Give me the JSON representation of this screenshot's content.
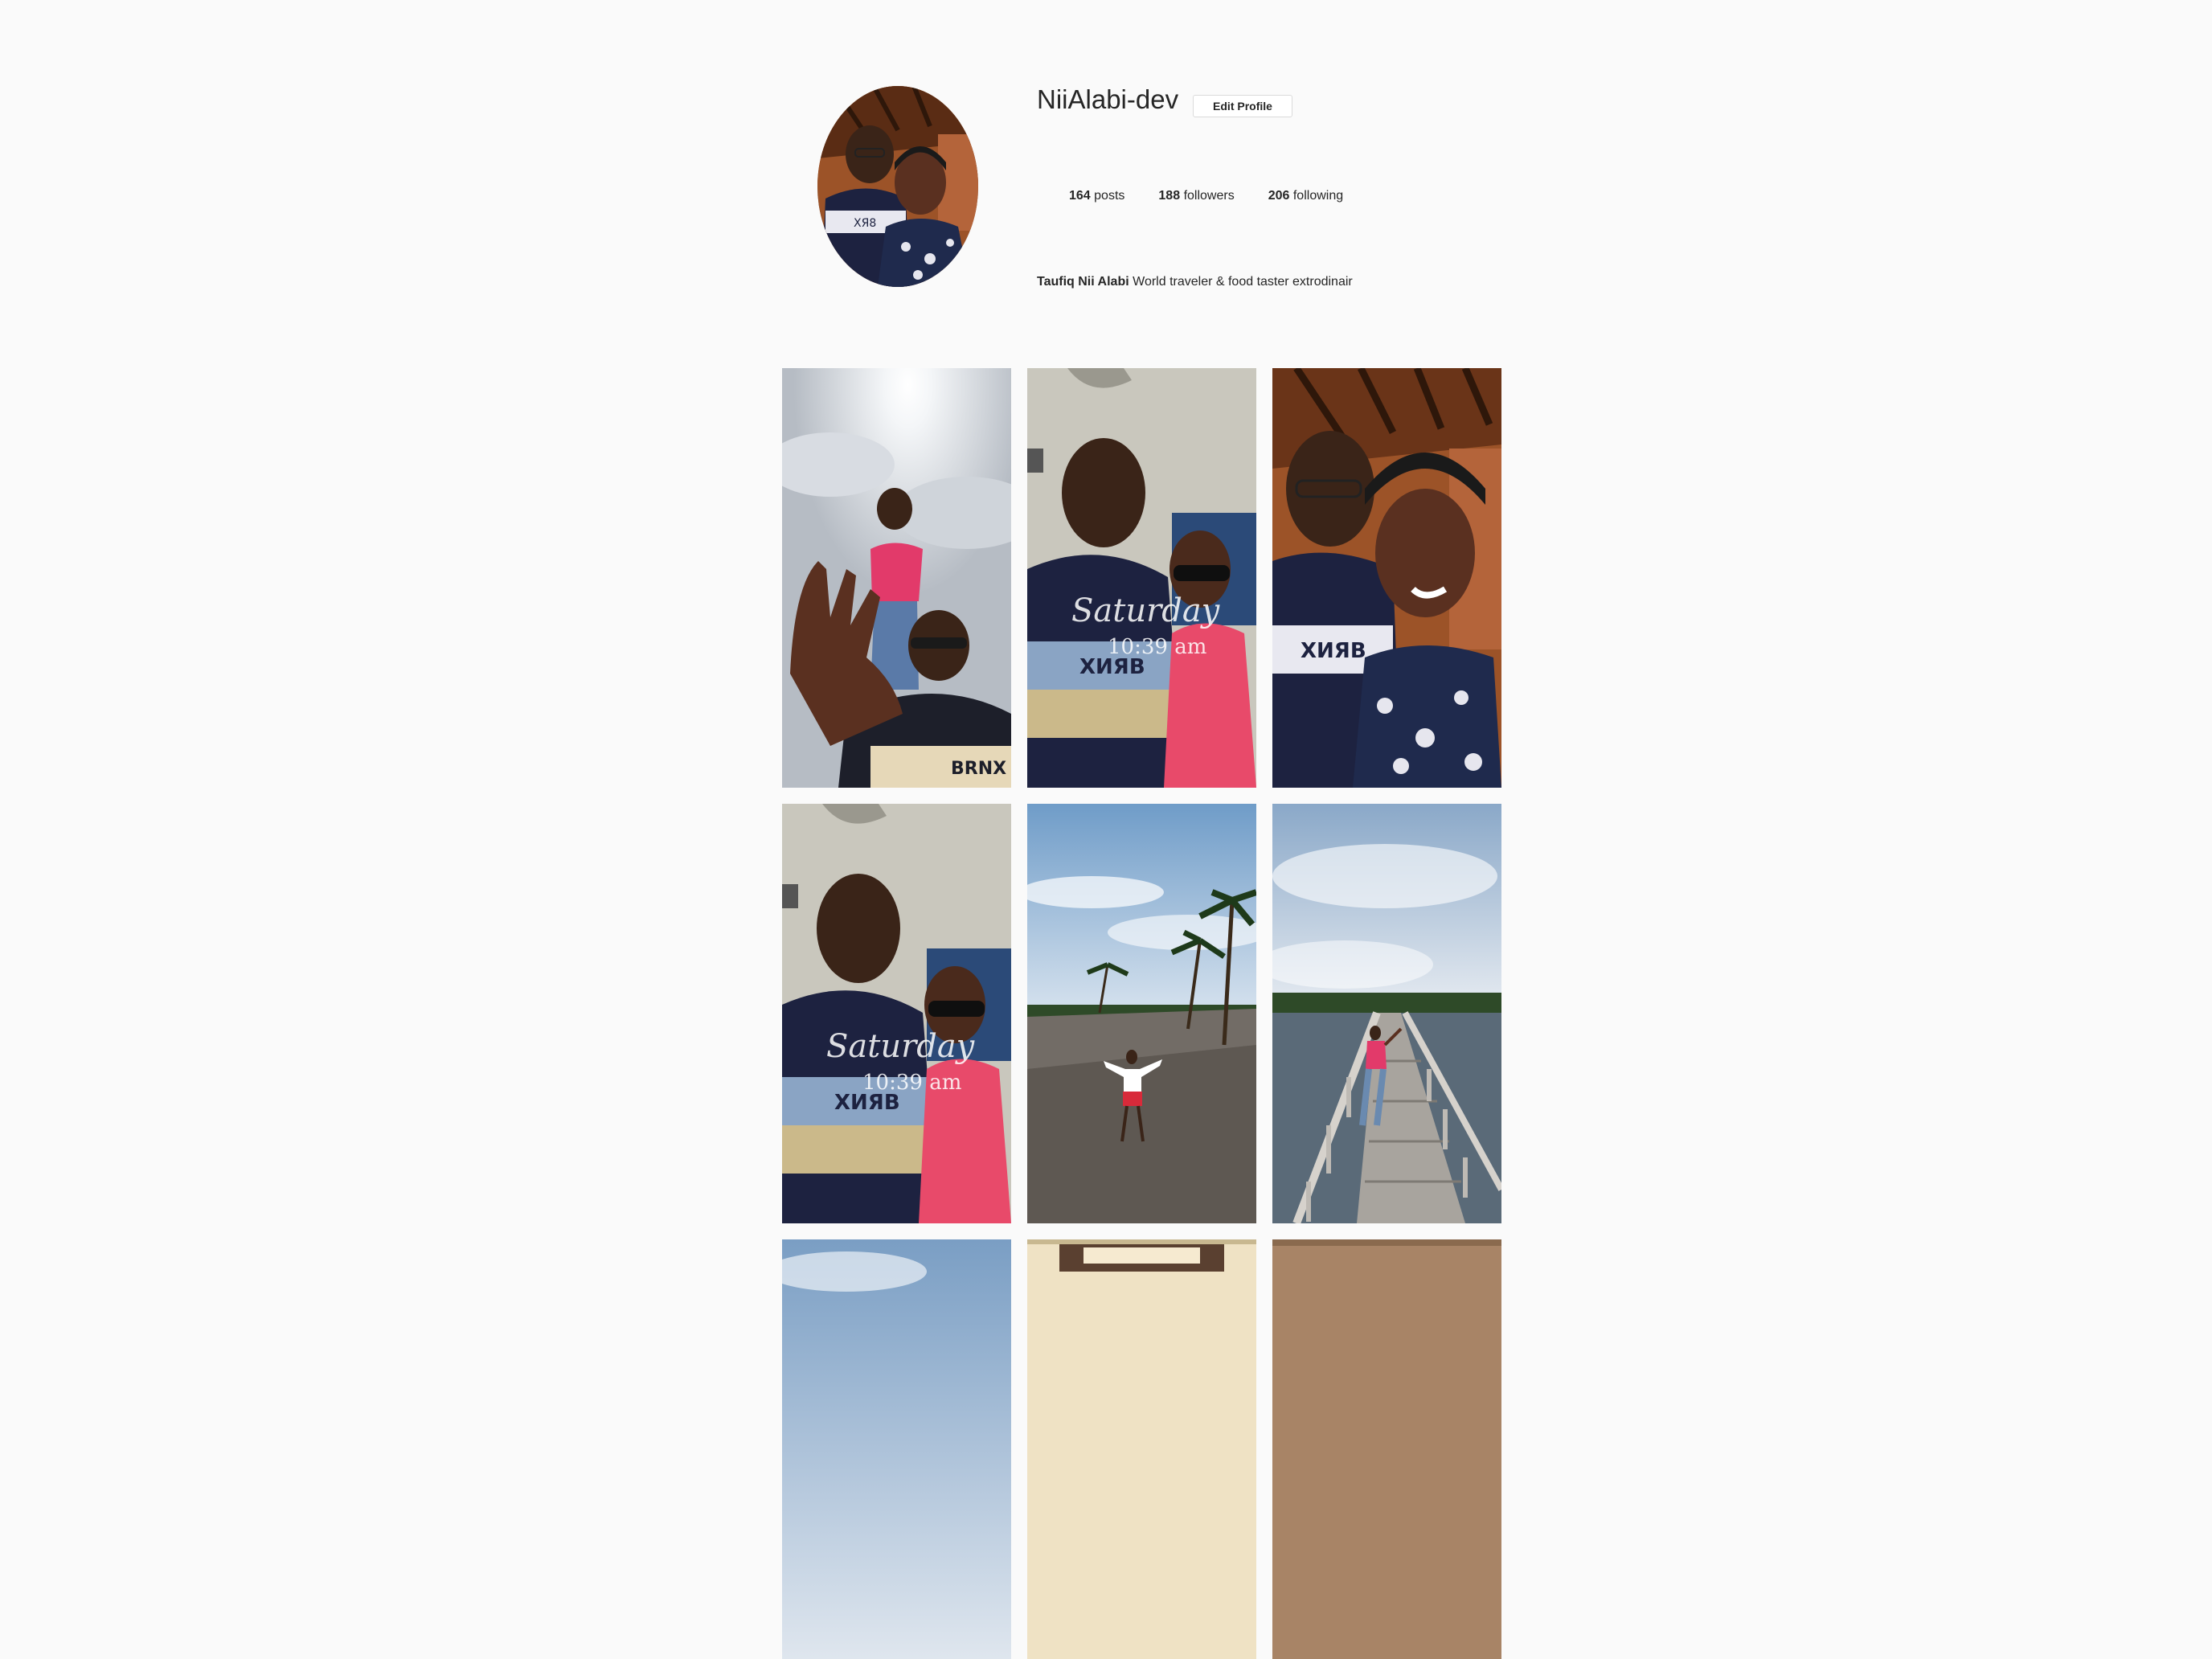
{
  "profile": {
    "username": "NiiAlabi-dev",
    "edit_label": "Edit Profile",
    "stats": {
      "posts_count": "164",
      "posts_label": "posts",
      "followers_count": "188",
      "followers_label": "followers",
      "following_count": "206",
      "following_label": "following"
    },
    "bio": {
      "name": "Taufiq Nii Alabi",
      "text": "World traveler & food taster extrodinair"
    }
  },
  "posts": [
    {
      "scene": "sky-selfie-waving"
    },
    {
      "scene": "car-selfie"
    },
    {
      "scene": "couple-selfie-roof"
    },
    {
      "scene": "car-selfie"
    },
    {
      "scene": "beach-palms"
    },
    {
      "scene": "boardwalk"
    },
    {
      "scene": "sky"
    },
    {
      "scene": "ceiling-light"
    },
    {
      "scene": "brown-wall"
    }
  ],
  "colors": {
    "background": "#fafafa",
    "text": "#262626",
    "border": "#dbdbdb"
  }
}
